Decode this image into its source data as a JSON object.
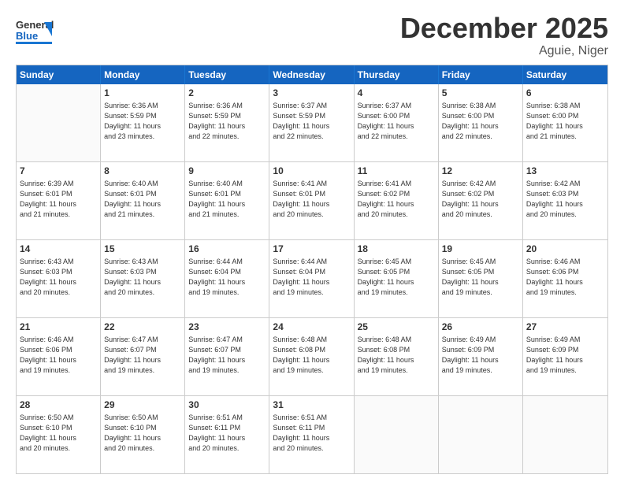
{
  "header": {
    "logo_general": "General",
    "logo_blue": "Blue",
    "month_title": "December 2025",
    "location": "Aguie, Niger"
  },
  "weekdays": [
    "Sunday",
    "Monday",
    "Tuesday",
    "Wednesday",
    "Thursday",
    "Friday",
    "Saturday"
  ],
  "rows": [
    [
      {
        "day": "",
        "info": ""
      },
      {
        "day": "1",
        "info": "Sunrise: 6:36 AM\nSunset: 5:59 PM\nDaylight: 11 hours\nand 23 minutes."
      },
      {
        "day": "2",
        "info": "Sunrise: 6:36 AM\nSunset: 5:59 PM\nDaylight: 11 hours\nand 22 minutes."
      },
      {
        "day": "3",
        "info": "Sunrise: 6:37 AM\nSunset: 5:59 PM\nDaylight: 11 hours\nand 22 minutes."
      },
      {
        "day": "4",
        "info": "Sunrise: 6:37 AM\nSunset: 6:00 PM\nDaylight: 11 hours\nand 22 minutes."
      },
      {
        "day": "5",
        "info": "Sunrise: 6:38 AM\nSunset: 6:00 PM\nDaylight: 11 hours\nand 22 minutes."
      },
      {
        "day": "6",
        "info": "Sunrise: 6:38 AM\nSunset: 6:00 PM\nDaylight: 11 hours\nand 21 minutes."
      }
    ],
    [
      {
        "day": "7",
        "info": "Sunrise: 6:39 AM\nSunset: 6:01 PM\nDaylight: 11 hours\nand 21 minutes."
      },
      {
        "day": "8",
        "info": "Sunrise: 6:40 AM\nSunset: 6:01 PM\nDaylight: 11 hours\nand 21 minutes."
      },
      {
        "day": "9",
        "info": "Sunrise: 6:40 AM\nSunset: 6:01 PM\nDaylight: 11 hours\nand 21 minutes."
      },
      {
        "day": "10",
        "info": "Sunrise: 6:41 AM\nSunset: 6:01 PM\nDaylight: 11 hours\nand 20 minutes."
      },
      {
        "day": "11",
        "info": "Sunrise: 6:41 AM\nSunset: 6:02 PM\nDaylight: 11 hours\nand 20 minutes."
      },
      {
        "day": "12",
        "info": "Sunrise: 6:42 AM\nSunset: 6:02 PM\nDaylight: 11 hours\nand 20 minutes."
      },
      {
        "day": "13",
        "info": "Sunrise: 6:42 AM\nSunset: 6:03 PM\nDaylight: 11 hours\nand 20 minutes."
      }
    ],
    [
      {
        "day": "14",
        "info": "Sunrise: 6:43 AM\nSunset: 6:03 PM\nDaylight: 11 hours\nand 20 minutes."
      },
      {
        "day": "15",
        "info": "Sunrise: 6:43 AM\nSunset: 6:03 PM\nDaylight: 11 hours\nand 20 minutes."
      },
      {
        "day": "16",
        "info": "Sunrise: 6:44 AM\nSunset: 6:04 PM\nDaylight: 11 hours\nand 19 minutes."
      },
      {
        "day": "17",
        "info": "Sunrise: 6:44 AM\nSunset: 6:04 PM\nDaylight: 11 hours\nand 19 minutes."
      },
      {
        "day": "18",
        "info": "Sunrise: 6:45 AM\nSunset: 6:05 PM\nDaylight: 11 hours\nand 19 minutes."
      },
      {
        "day": "19",
        "info": "Sunrise: 6:45 AM\nSunset: 6:05 PM\nDaylight: 11 hours\nand 19 minutes."
      },
      {
        "day": "20",
        "info": "Sunrise: 6:46 AM\nSunset: 6:06 PM\nDaylight: 11 hours\nand 19 minutes."
      }
    ],
    [
      {
        "day": "21",
        "info": "Sunrise: 6:46 AM\nSunset: 6:06 PM\nDaylight: 11 hours\nand 19 minutes."
      },
      {
        "day": "22",
        "info": "Sunrise: 6:47 AM\nSunset: 6:07 PM\nDaylight: 11 hours\nand 19 minutes."
      },
      {
        "day": "23",
        "info": "Sunrise: 6:47 AM\nSunset: 6:07 PM\nDaylight: 11 hours\nand 19 minutes."
      },
      {
        "day": "24",
        "info": "Sunrise: 6:48 AM\nSunset: 6:08 PM\nDaylight: 11 hours\nand 19 minutes."
      },
      {
        "day": "25",
        "info": "Sunrise: 6:48 AM\nSunset: 6:08 PM\nDaylight: 11 hours\nand 19 minutes."
      },
      {
        "day": "26",
        "info": "Sunrise: 6:49 AM\nSunset: 6:09 PM\nDaylight: 11 hours\nand 19 minutes."
      },
      {
        "day": "27",
        "info": "Sunrise: 6:49 AM\nSunset: 6:09 PM\nDaylight: 11 hours\nand 19 minutes."
      }
    ],
    [
      {
        "day": "28",
        "info": "Sunrise: 6:50 AM\nSunset: 6:10 PM\nDaylight: 11 hours\nand 20 minutes."
      },
      {
        "day": "29",
        "info": "Sunrise: 6:50 AM\nSunset: 6:10 PM\nDaylight: 11 hours\nand 20 minutes."
      },
      {
        "day": "30",
        "info": "Sunrise: 6:51 AM\nSunset: 6:11 PM\nDaylight: 11 hours\nand 20 minutes."
      },
      {
        "day": "31",
        "info": "Sunrise: 6:51 AM\nSunset: 6:11 PM\nDaylight: 11 hours\nand 20 minutes."
      },
      {
        "day": "",
        "info": ""
      },
      {
        "day": "",
        "info": ""
      },
      {
        "day": "",
        "info": ""
      }
    ]
  ]
}
